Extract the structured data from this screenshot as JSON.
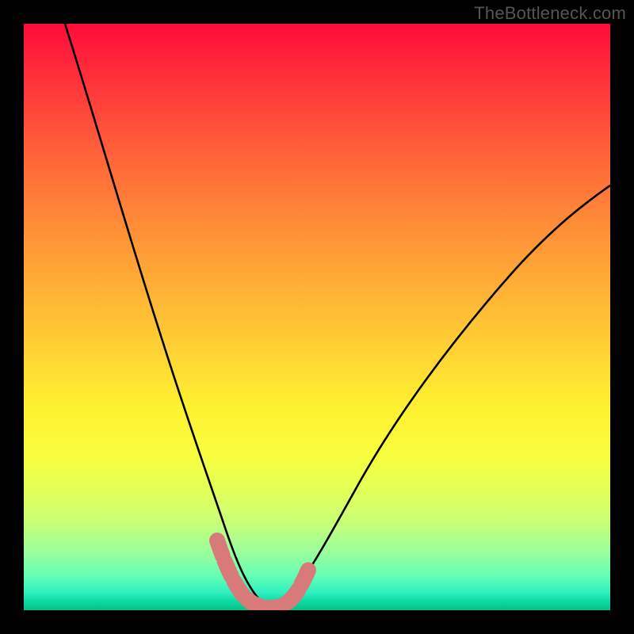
{
  "watermark": "TheBottleneck.com",
  "colors": {
    "curve_stroke": "#000000",
    "highlight_stroke": "#d97a7a",
    "frame_bg": "#000000"
  },
  "chart_data": {
    "type": "line",
    "title": "",
    "xlabel": "",
    "ylabel": "",
    "xlim": [
      0,
      100
    ],
    "ylim": [
      0,
      100
    ],
    "grid": false,
    "series": [
      {
        "name": "bottleneck-curve-left",
        "x": [
          7,
          10,
          14,
          18,
          22,
          26,
          28,
          30,
          32,
          34,
          35.5,
          37,
          38.5,
          40,
          41.5
        ],
        "y": [
          100,
          86,
          70,
          54,
          38,
          24,
          18,
          13,
          9,
          6,
          4,
          3,
          2,
          1.5,
          1.2
        ]
      },
      {
        "name": "bottleneck-curve-right",
        "x": [
          41.5,
          43,
          45,
          48,
          52,
          58,
          66,
          76,
          88,
          100
        ],
        "y": [
          1.2,
          2.3,
          4.5,
          8,
          14,
          23,
          35,
          48,
          60,
          71
        ]
      },
      {
        "name": "highlight-segment",
        "x": [
          32,
          34,
          36,
          38,
          40,
          42,
          44,
          46
        ],
        "y": [
          9,
          6,
          3.5,
          2,
          1.5,
          2,
          3.5,
          6
        ]
      }
    ]
  }
}
